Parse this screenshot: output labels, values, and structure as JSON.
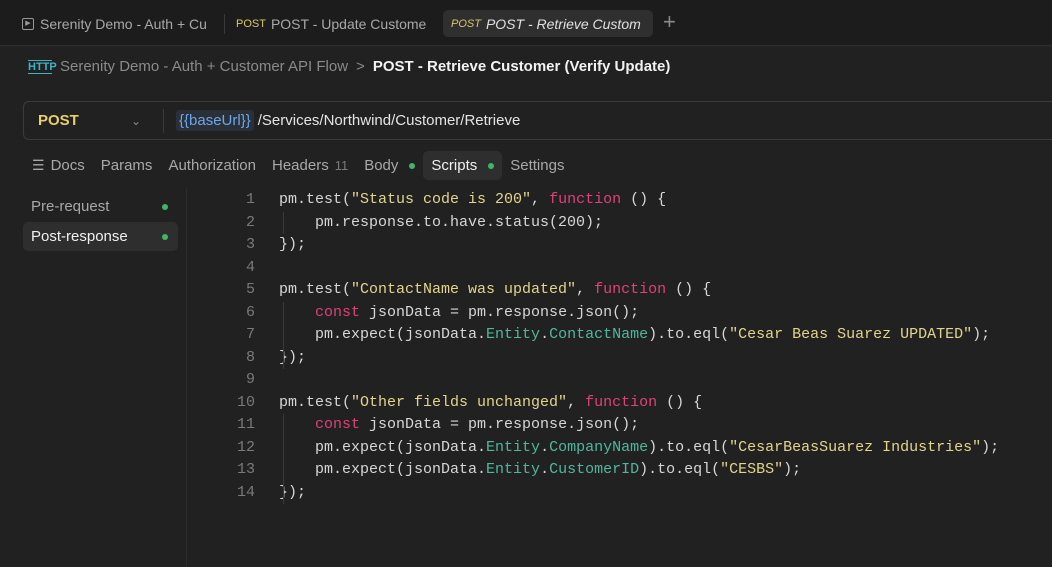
{
  "tabs": [
    {
      "method": "",
      "label": "Serenity Demo - Auth + Cu",
      "icon": "collection-runner-icon"
    },
    {
      "method": "POST",
      "label": "POST - Update Custome"
    },
    {
      "method": "POST",
      "label": "POST - Retrieve Custom",
      "active": true
    }
  ],
  "breadcrumb": {
    "icon": "HTTP",
    "collection": "Serenity Demo - Auth + Customer API Flow",
    "separator": ">",
    "title": "POST - Retrieve Customer (Verify Update)"
  },
  "request": {
    "method": "POST",
    "url_var": "{{baseUrl}}",
    "url_path": "/Services/Northwind/Customer/Retrieve"
  },
  "request_tabs": {
    "docs": "Docs",
    "params": "Params",
    "authorization": "Authorization",
    "headers": "Headers",
    "headers_count": "11",
    "body": "Body",
    "scripts": "Scripts",
    "settings": "Settings"
  },
  "script_tabs": {
    "pre": "Pre-request",
    "post": "Post-response"
  },
  "code": [
    [
      [
        "t",
        "pm.test("
      ],
      [
        "s",
        "\"Status code is 200\""
      ],
      [
        "t",
        ", "
      ],
      [
        "k",
        "function"
      ],
      [
        "t",
        " () {"
      ]
    ],
    [
      [
        "t",
        "    pm.response.to.have.status(200);"
      ]
    ],
    [
      [
        "t",
        "});"
      ]
    ],
    [],
    [
      [
        "t",
        "pm.test("
      ],
      [
        "s",
        "\"ContactName was updated\""
      ],
      [
        "t",
        ", "
      ],
      [
        "k",
        "function"
      ],
      [
        "t",
        " () {"
      ]
    ],
    [
      [
        "t",
        "    "
      ],
      [
        "k",
        "const"
      ],
      [
        "t",
        " jsonData = pm.response.json();"
      ]
    ],
    [
      [
        "t",
        "    pm.expect(jsonData."
      ],
      [
        "p",
        "Entity"
      ],
      [
        "t",
        "."
      ],
      [
        "p",
        "ContactName"
      ],
      [
        "t",
        ").to.eql("
      ],
      [
        "s",
        "\"Cesar Beas Suarez UPDATED\""
      ],
      [
        "t",
        ");"
      ]
    ],
    [
      [
        "t",
        "});"
      ]
    ],
    [],
    [
      [
        "t",
        "pm.test("
      ],
      [
        "s",
        "\"Other fields unchanged\""
      ],
      [
        "t",
        ", "
      ],
      [
        "k",
        "function"
      ],
      [
        "t",
        " () {"
      ]
    ],
    [
      [
        "t",
        "    "
      ],
      [
        "k",
        "const"
      ],
      [
        "t",
        " jsonData = pm.response.json();"
      ]
    ],
    [
      [
        "t",
        "    pm.expect(jsonData."
      ],
      [
        "p",
        "Entity"
      ],
      [
        "t",
        "."
      ],
      [
        "p",
        "CompanyName"
      ],
      [
        "t",
        ").to.eql("
      ],
      [
        "s",
        "\"CesarBeasSuarez Industries\""
      ],
      [
        "t",
        ");"
      ]
    ],
    [
      [
        "t",
        "    pm.expect(jsonData."
      ],
      [
        "p",
        "Entity"
      ],
      [
        "t",
        "."
      ],
      [
        "p",
        "CustomerID"
      ],
      [
        "t",
        ").to.eql("
      ],
      [
        "s",
        "\"CESBS\""
      ],
      [
        "t",
        ");"
      ]
    ],
    [
      [
        "t",
        "});"
      ]
    ]
  ]
}
